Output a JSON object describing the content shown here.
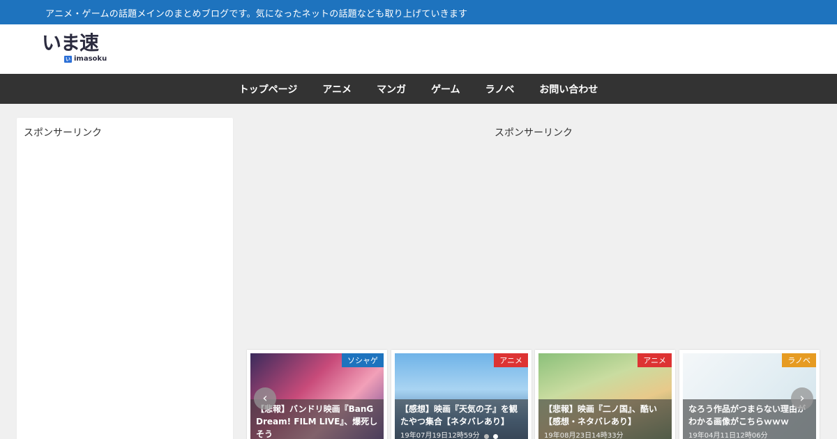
{
  "topbar": {
    "tagline": "アニメ・ゲームの話題メインのまとめブログです。気になったネットの話題なども取り上げていきます"
  },
  "logo": {
    "main": "いま速",
    "mark": "いま",
    "sub": "imasoku"
  },
  "nav": [
    "トップページ",
    "アニメ",
    "マンガ",
    "ゲーム",
    "ラノベ",
    "お問い合わせ"
  ],
  "sidebar": {
    "sponsor": "スポンサーリンク"
  },
  "main": {
    "sponsor": "スポンサーリンク"
  },
  "carousel": {
    "prev": "‹",
    "next": "›",
    "cards": [
      {
        "category": "ソシャゲ",
        "category_color": "#1e73be",
        "title": "【悲報】バンドリ映画『BanG Dream! FILM LIVE』、爆死しそう",
        "date": ""
      },
      {
        "category": "アニメ",
        "category_color": "#dd3333",
        "title": "【感想】映画『天気の子』を観たやつ集合【ネタバレあり】",
        "date": "19年07月19日12時59分"
      },
      {
        "category": "アニメ",
        "category_color": "#dd3333",
        "title": "【悲報】映画『二ノ国』、酷い【感想・ネタバレあり】",
        "date": "19年08月23日14時33分"
      },
      {
        "category": "ラノベ",
        "category_color": "#e69b22",
        "title": "なろう作品がつまらない理由がわかる画像がこちらｗｗｗ",
        "date": "19年04月11日12時06分"
      }
    ]
  }
}
